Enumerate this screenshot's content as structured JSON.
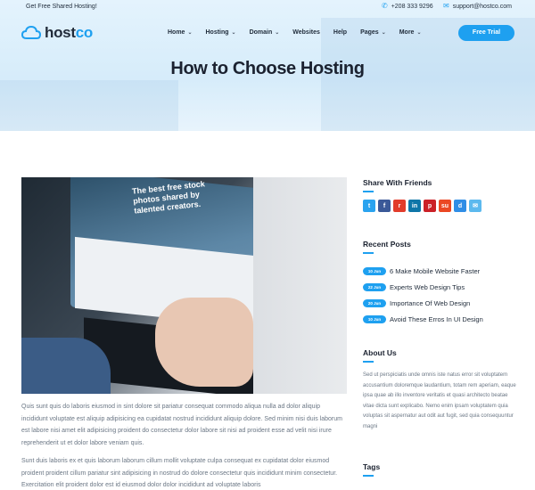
{
  "topbar": {
    "promo": "Get Free Shared Hosting!",
    "phone": "+208 333 9296",
    "email": "support@hostco.com"
  },
  "brand": {
    "name_part1": "host",
    "name_part2": "co"
  },
  "nav": [
    {
      "label": "Home",
      "dropdown": true
    },
    {
      "label": "Hosting",
      "dropdown": true
    },
    {
      "label": "Domain",
      "dropdown": true
    },
    {
      "label": "Websites",
      "dropdown": false
    },
    {
      "label": "Help",
      "dropdown": false
    },
    {
      "label": "Pages",
      "dropdown": true
    },
    {
      "label": "More",
      "dropdown": true
    }
  ],
  "cta": {
    "label": "Free Trial"
  },
  "hero": {
    "title": "How to Choose Hosting"
  },
  "image": {
    "caption": "The best free stock photos shared by talented creators."
  },
  "article": {
    "p1": "Quis sunt quis do laboris eiusmod in sint dolore sit pariatur consequat commodo aliqua nulla ad dolor aliquip incididunt voluptate est aliquip adipisicing ea cupidatat nostrud incididunt aliquip dolore. Sed minim nisi duis laborum est labore nisi amet elit adipisicing proident do consectetur dolor labore sit nisi ad proident esse ad velit nisi irure reprehenderit ut et dolor labore veniam quis.",
    "p2": "Sunt duis laboris ex et quis laborum laborum cillum mollit voluptate culpa consequat ex cupidatat dolor eiusmod proident proident cillum pariatur sint adipisicing in nostrud do dolore consectetur quis incididunt minim consectetur. Exercitation elit proident dolor est id eiusmod dolor dolor incididunt ad voluptate laboris"
  },
  "sidebar": {
    "share_title": "Share With Friends",
    "socials": [
      {
        "name": "twitter-icon",
        "glyph": "t",
        "color": "#2aa3ef"
      },
      {
        "name": "facebook-icon",
        "glyph": "f",
        "color": "#3b5998"
      },
      {
        "name": "reddit-icon",
        "glyph": "r",
        "color": "#e23c2b"
      },
      {
        "name": "linkedin-icon",
        "glyph": "in",
        "color": "#0e76a8"
      },
      {
        "name": "pinterest-icon",
        "glyph": "p",
        "color": "#cb2027"
      },
      {
        "name": "stumbleupon-icon",
        "glyph": "su",
        "color": "#eb4823"
      },
      {
        "name": "delicious-icon",
        "glyph": "d",
        "color": "#2f8ee6"
      },
      {
        "name": "email-icon",
        "glyph": "✉",
        "color": "#5cb9ee"
      }
    ],
    "recent_title": "Recent Posts",
    "posts": [
      {
        "date": "10 Jun",
        "title": "6 Make Mobile Website Faster"
      },
      {
        "date": "22 Jun",
        "title": "Experts Web Design Tips"
      },
      {
        "date": "20 Jun",
        "title": "Importance Of Web Design"
      },
      {
        "date": "10 Jun",
        "title": "Avoid These Erros In UI Design"
      }
    ],
    "about_title": "About Us",
    "about_text": "Sed ut perspiciatis unde omnis iste natus error sit voluptatem accusantium doloremque laudantium, totam rem aperiam, eaque ipsa quae ab illo inventore veritatis et quasi architecto beatae vitae dicta sunt explicabo. Nemo enim ipsam voluptatem quia voluptas sit aspernatur aut odit aut fugit, sed quia consequuntur magni",
    "tags_title": "Tags"
  },
  "colors": {
    "accent": "#1ea0f0",
    "heading": "#1b2230",
    "body_text": "#6b7785"
  }
}
